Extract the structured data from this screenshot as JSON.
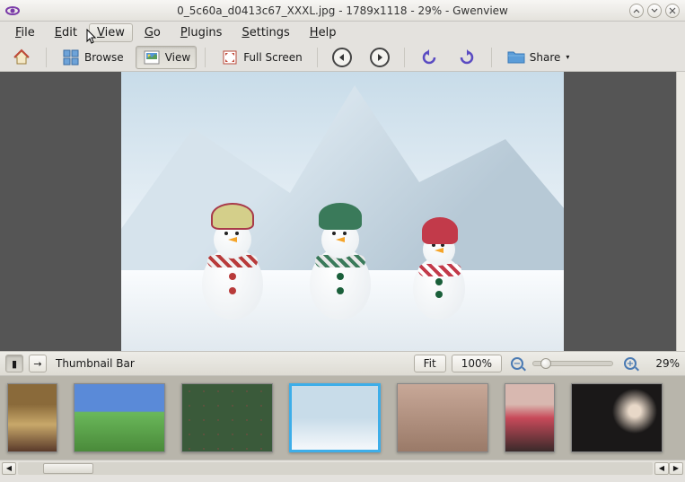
{
  "window": {
    "title": "0_5c60a_d0413c67_XXXL.jpg - 1789x1118 - 29% - Gwenview"
  },
  "menubar": {
    "items": [
      {
        "label": "File",
        "ul": "F"
      },
      {
        "label": "Edit",
        "ul": "E"
      },
      {
        "label": "View",
        "ul": "V"
      },
      {
        "label": "Go",
        "ul": "G"
      },
      {
        "label": "Plugins",
        "ul": "P"
      },
      {
        "label": "Settings",
        "ul": "S"
      },
      {
        "label": "Help",
        "ul": "H"
      }
    ]
  },
  "toolbar": {
    "browse": "Browse",
    "view": "View",
    "fullscreen": "Full Screen",
    "share": "Share"
  },
  "controlbar": {
    "thumbnail_bar": "Thumbnail Bar",
    "fit": "Fit",
    "hundred": "100%",
    "zoom": "29%"
  },
  "image": {
    "filename": "0_5c60a_d0413c67_XXXL.jpg",
    "dimensions": "1789x1118",
    "zoom_percent": 29,
    "description": "three-snowmen-winter-scene"
  },
  "thumbnails": {
    "count": 7,
    "selected_index": 3
  }
}
